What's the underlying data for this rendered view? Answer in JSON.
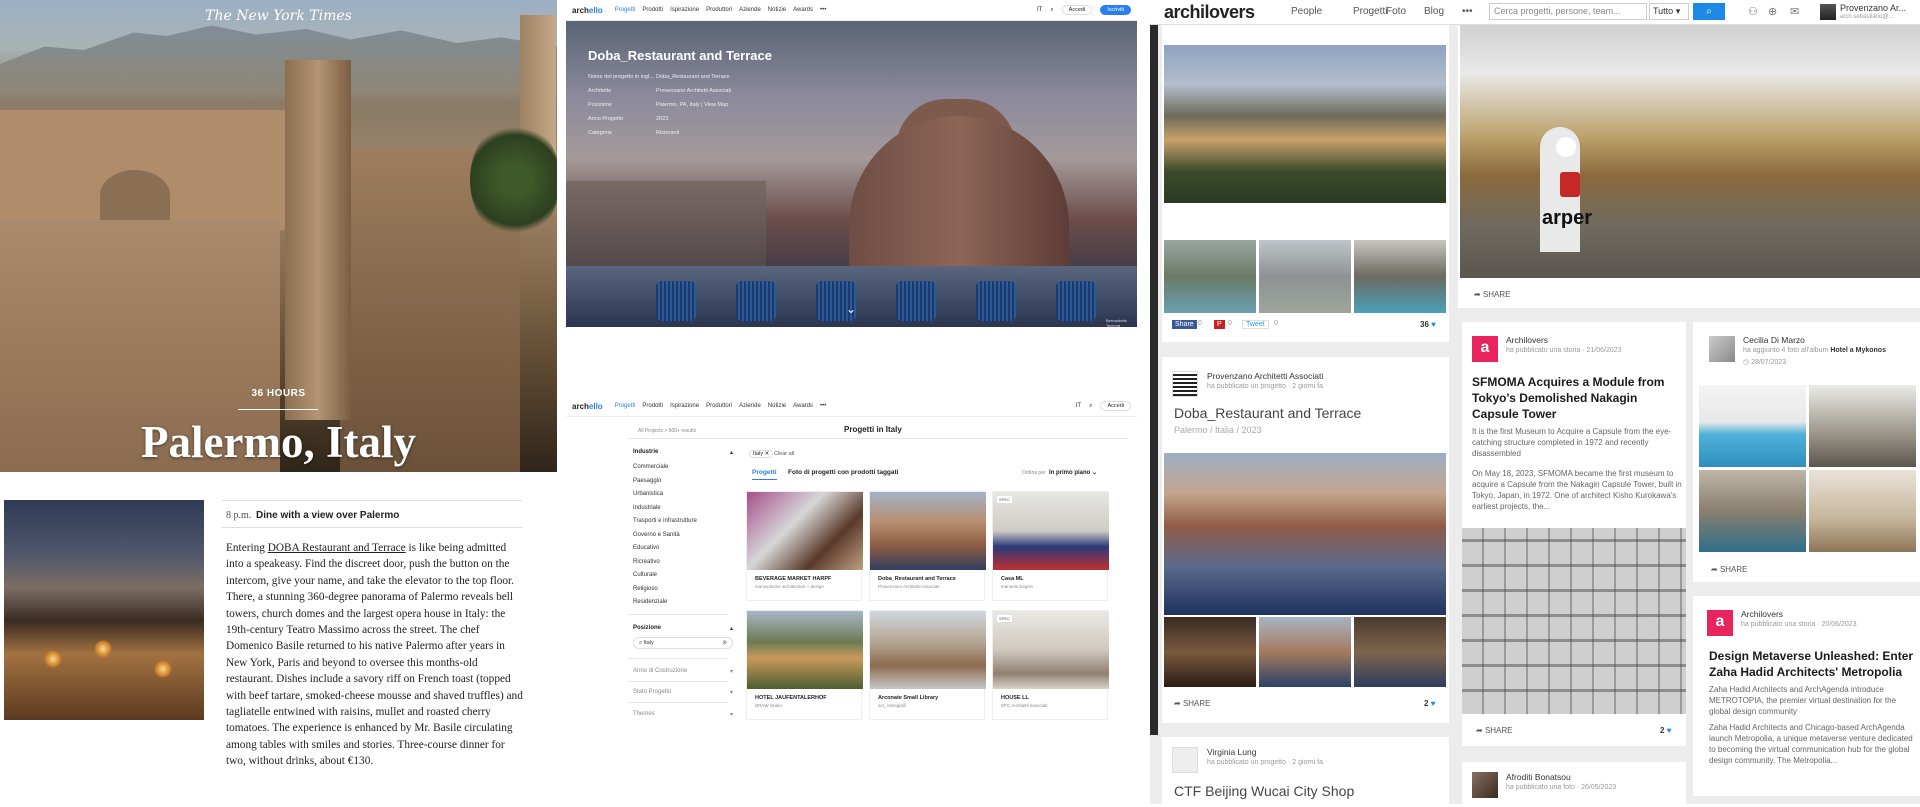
{
  "nyt": {
    "logo": "The New York Times",
    "kicker": "36 HOURS",
    "title": "Palermo, Italy",
    "time": "8 p.m.",
    "event": "Dine with a view over Palermo",
    "body_start": "Entering ",
    "body_link": "DOBA Restaurant and Terrace",
    "body_rest": " is like being admitted into a speakeasy. Find the discreet door, push the button on the intercom, give your name, and take the elevator to the top floor. There, a stunning 360-degree panorama of Palermo reveals bell towers, church domes and the largest opera house in Italy: the 19th-century Teatro Massimo across the street. The chef Domenico Basile returned to his native Palermo after years in New York, Paris and beyond to oversee this months-old restaurant. Dishes include a savory riff on French toast (topped with beef tartare, smoked-cheese mousse and shaved truffles) and tagliatelle entwined with raisins, mullet and roasted cherry tomatoes. The experience is enhanced by Mr. Basile circulating among tables with smiles and stories. Three-course dinner for two, without drinks, about €130."
  },
  "archello_top": {
    "logo_a": "arch",
    "logo_b": "ello",
    "menu": [
      "Progetti",
      "Prodotti",
      "Ispirazione",
      "Produttori",
      "Aziende",
      "Notizie",
      "Awards",
      "•••"
    ],
    "lang": "IT",
    "login": "Accedi",
    "signup": "Iscriviti",
    "title": "Doba_Restaurant and Terrace",
    "meta": [
      {
        "k": "Nome del progetto in ingl...",
        "v": "Doba_Restaurant and Terrace"
      },
      {
        "k": "Architetto",
        "v": "Provenzano Architetti Associati"
      },
      {
        "k": "Posizione",
        "v": "Palermo, PA, Italy | View Map"
      },
      {
        "k": "Anno Progetto",
        "v": "2023"
      },
      {
        "k": "Categoria",
        "v": "Ristoranti"
      }
    ],
    "credit": "Bernardetto Taverna"
  },
  "archello_bottom": {
    "logo_a": "arch",
    "logo_b": "ello",
    "menu": [
      "Progetti",
      "Prodotti",
      "Ispirazione",
      "Produttori",
      "Aziende",
      "Notizie",
      "Awards",
      "•••"
    ],
    "lang": "IT",
    "login": "Accedi",
    "crumb": "All Projects  >  600+ results",
    "heading": "Progetti in Italy",
    "industry_hdr": "Industrie",
    "industries": [
      "Commerciale",
      "Paesaggio",
      "Urbanistica",
      "Industriale",
      "Trasporti e infrastrutture",
      "Governo e Sanità",
      "Educativo",
      "Ricreativo",
      "Culturale",
      "Religioso",
      "Residenziale"
    ],
    "position_hdr": "Posizione",
    "search_val": "Italy",
    "filters": [
      "Anno di Costruzione",
      "Stato Progetto",
      "Themes"
    ],
    "chip": "Italy",
    "clear": "Clear all",
    "tab1": "Progetti",
    "tab2": "Foto di progetti con prodotti taggati",
    "sort_lbl": "Ordina per",
    "sort_val": "In primo piano",
    "cards": [
      {
        "t": "BEVERAGE MARKET HARPF",
        "s": "monovolume architecture + design"
      },
      {
        "t": "Doba_Restaurant and Terrace",
        "s": "Provenzano Architetti Associati"
      },
      {
        "t": "Casa ML",
        "s": "manuela bognin"
      },
      {
        "t": "HOTEL JAUFENTALERHOF",
        "s": "DRAW studio"
      },
      {
        "t": "Arconate Small Library",
        "s": "act_romegialli"
      },
      {
        "t": "HOUSE LL",
        "s": "DFC Architetti associati"
      }
    ],
    "badge": "SPEC"
  },
  "archilovers": {
    "logo": "archilovers",
    "nav": [
      "People",
      "Progetti",
      "Foto",
      "Blog",
      "•••"
    ],
    "search_placeholder": "Cerca progetti, persone, team...",
    "select": "Tutto",
    "user": "Provenzano Ar...",
    "user_sub": "arch.sebastiano@...",
    "social": [
      "Share",
      "0",
      "0",
      "Tweet",
      "0"
    ],
    "likes1": "36",
    "share": "SHARE",
    "post1": {
      "name": "Provenzano Architetti Associati",
      "sub": "ha pubblicato un progetto  ·  2 giorni fa",
      "title": "Doba_Restaurant and Terrace",
      "loc": "Palermo / Italia / 2023",
      "likes": "2"
    },
    "post2": {
      "name": "Virginia Lung",
      "sub": "ha pubblicato un progetto  ·  2 giorni fa",
      "title": "CTF Beijing Wucai City Shop"
    },
    "brand_arper": "arper",
    "story1": {
      "name": "Archilovers",
      "sub": "ha pubblicato una storia  ·  21/06/2023",
      "title": "SFMOMA Acquires a Module from Tokyo's Demolished Nakagin Capsule Tower",
      "lead": "It is the first Museum to Acquire a Capsule from the eye-catching structure completed in 1972 and recently disassembled",
      "body": "On May 18, 2023, SFMOMA became the first museum to acquire a Capsule from the Nakagin Capsule Tower, built in Tokyo, Japan, in 1972. One of architect Kisho Kurokawa's earliest projects, the...",
      "likes": "2"
    },
    "story2": {
      "name": "Afroditi Bonatsou",
      "sub": "ha pubblicato una foto  ·  26/05/2023"
    },
    "album": {
      "name": "Cecilia Di Marzo",
      "sub_a": "ha aggiunto 4 foto all'album ",
      "sub_b": "Hotel a Mykonos",
      "date": "28/07/2023"
    },
    "story3": {
      "name": "Archilovers",
      "sub": "ha pubblicato una storia  ·  20/06/2023",
      "title": "Design Metaverse Unleashed: Enter Zaha Hadid Architects' Metropolia",
      "lead": "Zaha Hadid Architects and ArchAgenda introduce METROTOPIA, the premier virtual destination for the global design community",
      "body": "Zaha Hadid Architects and Chicago-based ArchAgenda launch Metropolia, a unique metaverse venture dedicated to becoming the virtual communication hub for the global design community. The Metropolia..."
    },
    "colors": {
      "accent": "#1e88e5",
      "brand": "#e8235d"
    }
  }
}
